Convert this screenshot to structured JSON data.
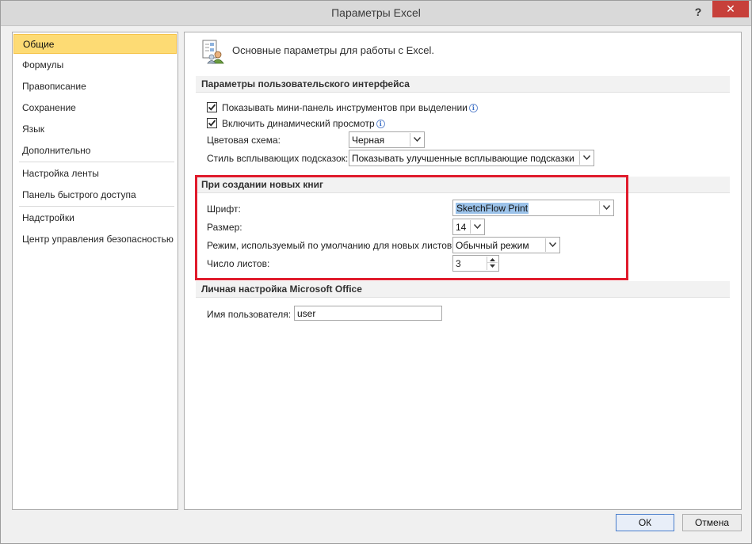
{
  "window": {
    "title": "Параметры Excel",
    "help_glyph": "?",
    "close_glyph": "✕"
  },
  "nav": {
    "items": [
      {
        "label": "Общие",
        "selected": true
      },
      {
        "label": "Формулы"
      },
      {
        "label": "Правописание"
      },
      {
        "label": "Сохранение"
      },
      {
        "label": "Язык"
      },
      {
        "label": "Дополнительно"
      },
      {
        "label": "Настройка ленты"
      },
      {
        "label": "Панель быстрого доступа"
      },
      {
        "label": "Надстройки"
      },
      {
        "label": "Центр управления безопасностью"
      }
    ]
  },
  "main": {
    "header": "Основные параметры для работы с Excel.",
    "ui_section": {
      "title": "Параметры пользовательского интерфейса",
      "mini_toolbar_label": "Показывать мини-панель инструментов при выделении",
      "mini_toolbar_checked": true,
      "live_preview_label": "Включить динамический просмотр",
      "live_preview_checked": true,
      "color_scheme_label": "Цветовая схема:",
      "color_scheme_value": "Черная",
      "tooltip_style_label": "Стиль всплывающих подсказок:",
      "tooltip_style_value": "Показывать улучшенные всплывающие подсказки"
    },
    "new_workbook_section": {
      "title": "При создании новых книг",
      "font_label": "Шрифт:",
      "font_value": "SketchFlow Print",
      "size_label": "Размер:",
      "size_value": "14",
      "view_label": "Режим, используемый по умолчанию для новых листов:",
      "view_value": "Обычный режим",
      "sheets_label": "Число листов:",
      "sheets_value": "3",
      "highlight_color": "#e01b2c"
    },
    "office_section": {
      "title": "Личная настройка Microsoft Office",
      "username_label": "Имя пользователя:",
      "username_value": "user"
    }
  },
  "buttons": {
    "ok": "ОК",
    "cancel": "Отмена"
  },
  "colors": {
    "selected_nav_bg": "#fddb74",
    "close_button": "#c7403a",
    "info_icon": "#3b6fc8"
  }
}
